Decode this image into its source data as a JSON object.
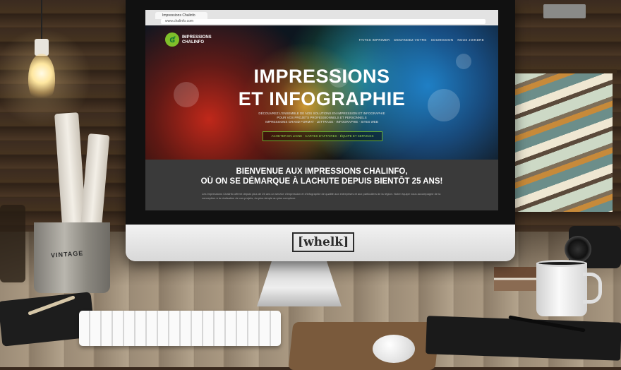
{
  "scene": {
    "monitor_brand": "[whelk]"
  },
  "browser": {
    "tab_title": "Impressions Chalinfo",
    "address": "www.chalinfo.com"
  },
  "site": {
    "logo_text_line1": "IMPRESSIONS",
    "logo_text_line2": "CHALINFO",
    "nav": [
      "FAITES IMPRIMER",
      "DEMANDEZ VOTRE",
      "SOUMISSION",
      "NOUS JOINDRE"
    ],
    "hero_title_line1": "IMPRESSIONS",
    "hero_title_line2": "ET INFOGRAPHIE",
    "hero_sub_line1": "DÉCOUVREZ L'ENSEMBLE DE NOS SOLUTIONS EN IMPRESSION ET INFOGRAPHIE",
    "hero_sub_line2": "POUR VOS PROJETS PROFESSIONNELS ET PERSONNELS",
    "hero_sub_line3": "IMPRESSIONS GRAND FORMAT · LETTRAGE · INFOGRAPHIE · SITES WEB",
    "cta_label": "ACHETER EN LIGNE · CARTES D'AFFAIRES · ÉQUIPE ET SERVICES",
    "welcome_line1": "BIENVENUE AUX IMPRESSIONS CHALINFO,",
    "welcome_line2": "OÙ ON SE DÉMARQUE À LACHUTE DEPUIS BIENTÔT 25 ANS!",
    "welcome_body": "Les Impressions Chalinfo offrent depuis plus de 25 ans un service d'impression et d'infographie de qualité aux entreprises et aux particuliers de la région. Notre équipe vous accompagne de la conception à la réalisation de vos projets, du plus simple au plus complexe."
  },
  "colors": {
    "accent_green": "#7fbf2a",
    "welcome_bg": "#3a3a3a"
  }
}
